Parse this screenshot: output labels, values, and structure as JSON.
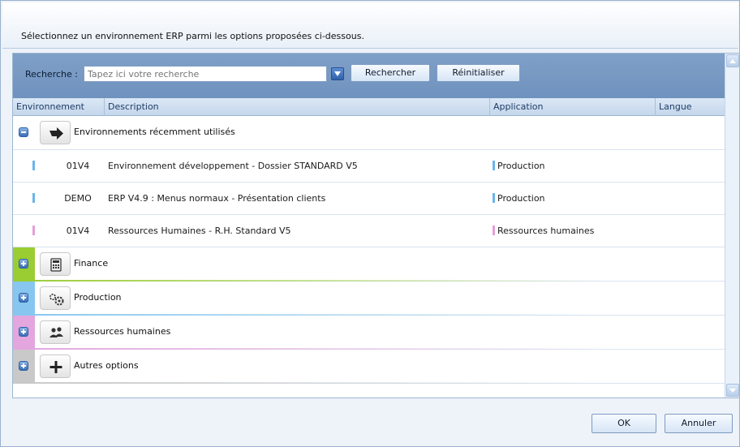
{
  "dialog": {
    "instruction": "Sélectionnez un environnement ERP parmi les options proposées ci-dessous."
  },
  "search": {
    "label": "Recherche :",
    "placeholder": "Tapez ici votre recherche",
    "search_button": "Rechercher",
    "reset_button": "Réinitialiser"
  },
  "columns": {
    "environment": "Environnement",
    "description": "Description",
    "application": "Application",
    "language": "Langue"
  },
  "groups": [
    {
      "label": "Environnements récemment utilisés",
      "expanded": true,
      "icon": "arrow-right-icon",
      "color": "#ffffff",
      "items": [
        {
          "env": "01V4",
          "description": "Environnement développement - Dossier STANDARD V5",
          "application": "Production",
          "color": "#6bb5e8"
        },
        {
          "env": "DEMO",
          "description": "ERP V4.9 : Menus normaux - Présentation clients",
          "application": "Production",
          "color": "#6bb5e8"
        },
        {
          "env": "01V4",
          "description": "Ressources Humaines - R.H. Standard V5",
          "application": "Ressources humaines",
          "color": "#e39fd9"
        }
      ]
    },
    {
      "label": "Finance",
      "expanded": false,
      "icon": "calculator-icon",
      "color": "#9acd32"
    },
    {
      "label": "Production",
      "expanded": false,
      "icon": "gears-icon",
      "color": "#87c7ef"
    },
    {
      "label": "Ressources humaines",
      "expanded": false,
      "icon": "users-icon",
      "color": "#e3a6de"
    },
    {
      "label": "Autres options",
      "expanded": false,
      "icon": "plus-icon",
      "color": "#c9c9c9"
    }
  ],
  "footer": {
    "ok_button": "OK",
    "cancel_button": "Annuler"
  }
}
